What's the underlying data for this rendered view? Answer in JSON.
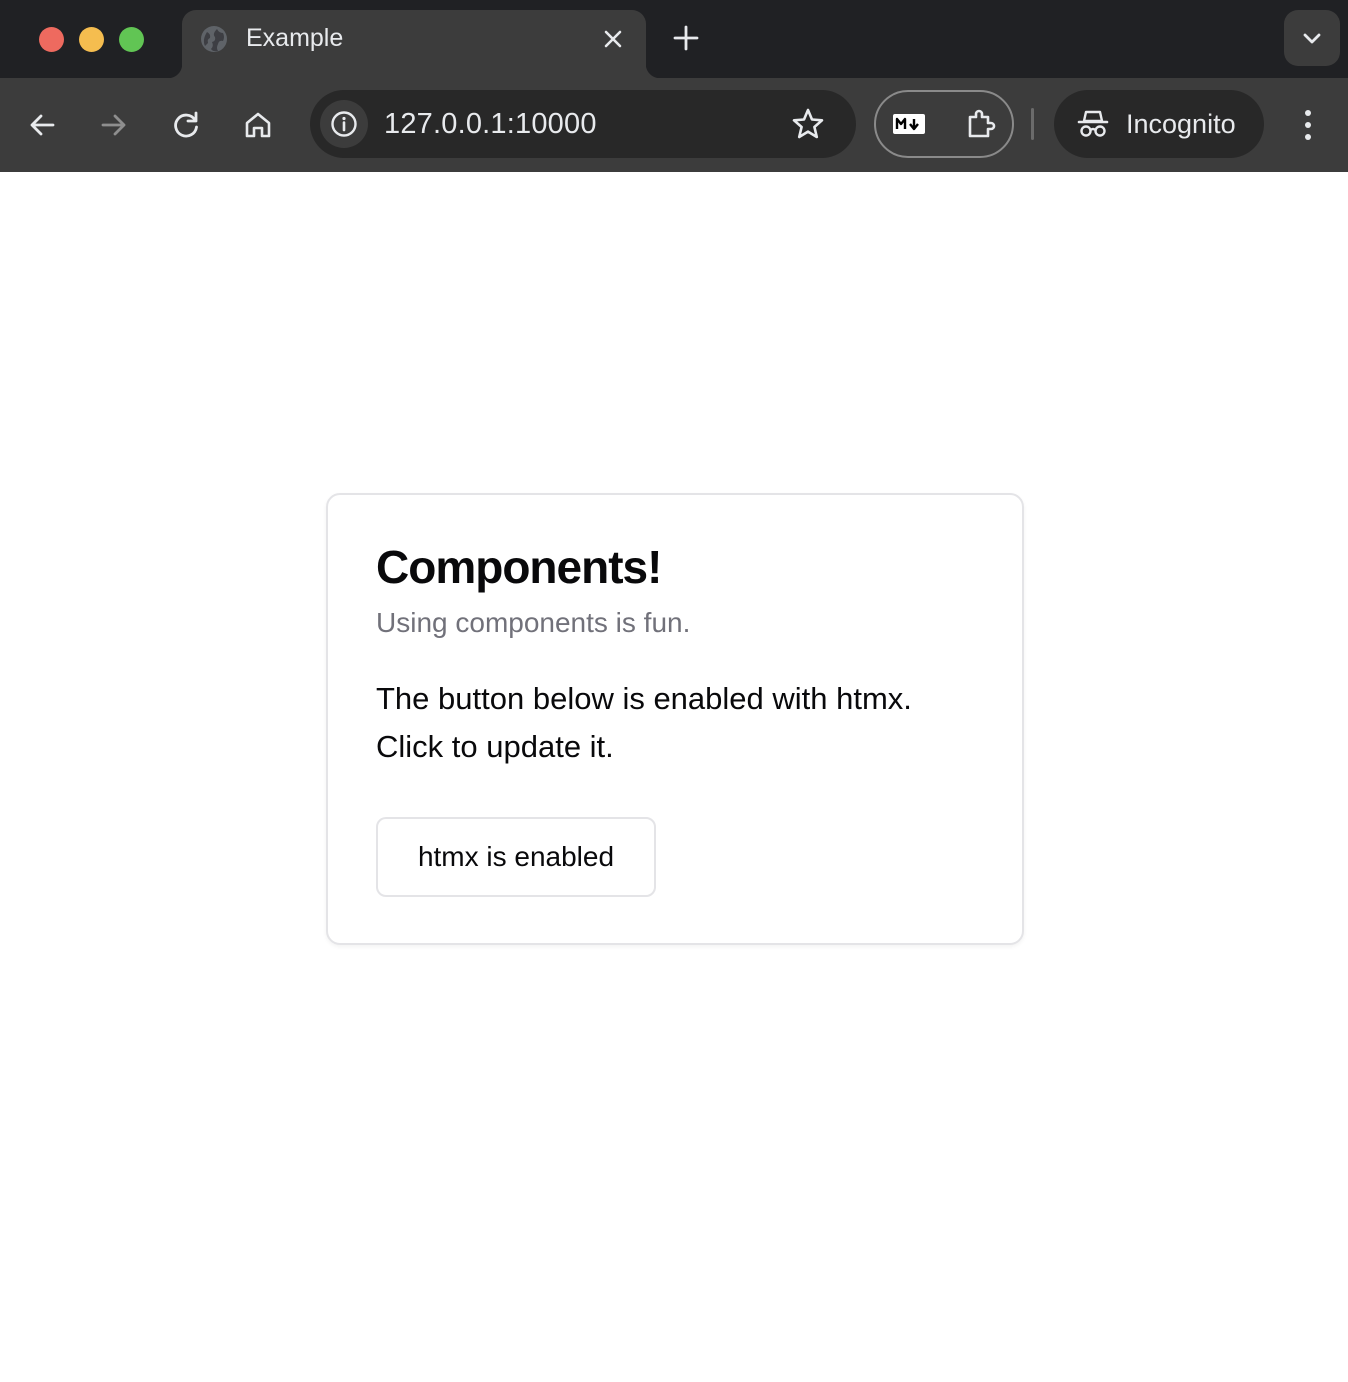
{
  "browser": {
    "tab": {
      "title": "Example",
      "favicon": "globe-icon"
    },
    "address_bar": {
      "url": "127.0.0.1:10000"
    },
    "profile": {
      "label": "Incognito"
    },
    "colors": {
      "chrome_dark": "#202124",
      "toolbar": "#3c3c3c",
      "traffic_red": "#ee6a5f",
      "traffic_yellow": "#f5bd4f",
      "traffic_green": "#61c554"
    }
  },
  "page": {
    "card": {
      "title": "Components!",
      "subtitle": "Using components is fun.",
      "body": "The button below is enabled with htmx. Click to update it.",
      "button_label": "htmx is enabled"
    }
  }
}
